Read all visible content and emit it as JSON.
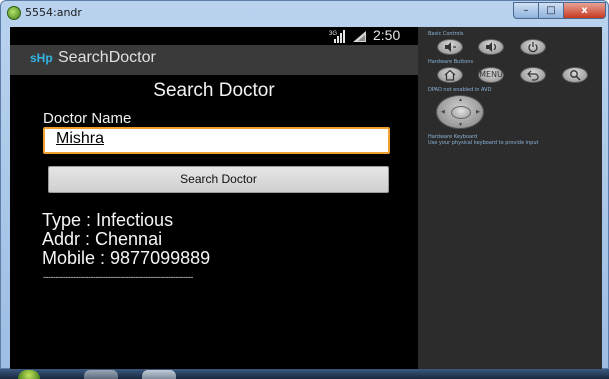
{
  "window": {
    "title": "5554:andr",
    "min_glyph": "–",
    "max_glyph": "□",
    "close_glyph": "x"
  },
  "statusbar": {
    "network": "3G",
    "time": "2:50"
  },
  "actionbar": {
    "logo_text": "sHp",
    "title": "SearchDoctor"
  },
  "form": {
    "heading": "Search Doctor",
    "doctor_label": "Doctor Name",
    "doctor_value": "Mishra",
    "search_button": "Search Doctor"
  },
  "result": {
    "type_line": "Type : Infectious",
    "addr_line": "Addr : Chennai",
    "mobile_line": "Mobile : 9877099889",
    "divider": "------------------------------------------------------------"
  },
  "controls": {
    "basic_label": "Basic Controls",
    "hardware_label": "Hardware Buttons",
    "menu_label": "MENU",
    "dpad_label": "DPAD not enabled in AVD",
    "keyboard_label_1": "Hardware Keyboard",
    "keyboard_label_2": "Use your physical keyboard to provide input"
  },
  "colors": {
    "input_focus_border": "#f0a030",
    "logo_accent": "#33b5e5",
    "screen_background": "#000000"
  }
}
